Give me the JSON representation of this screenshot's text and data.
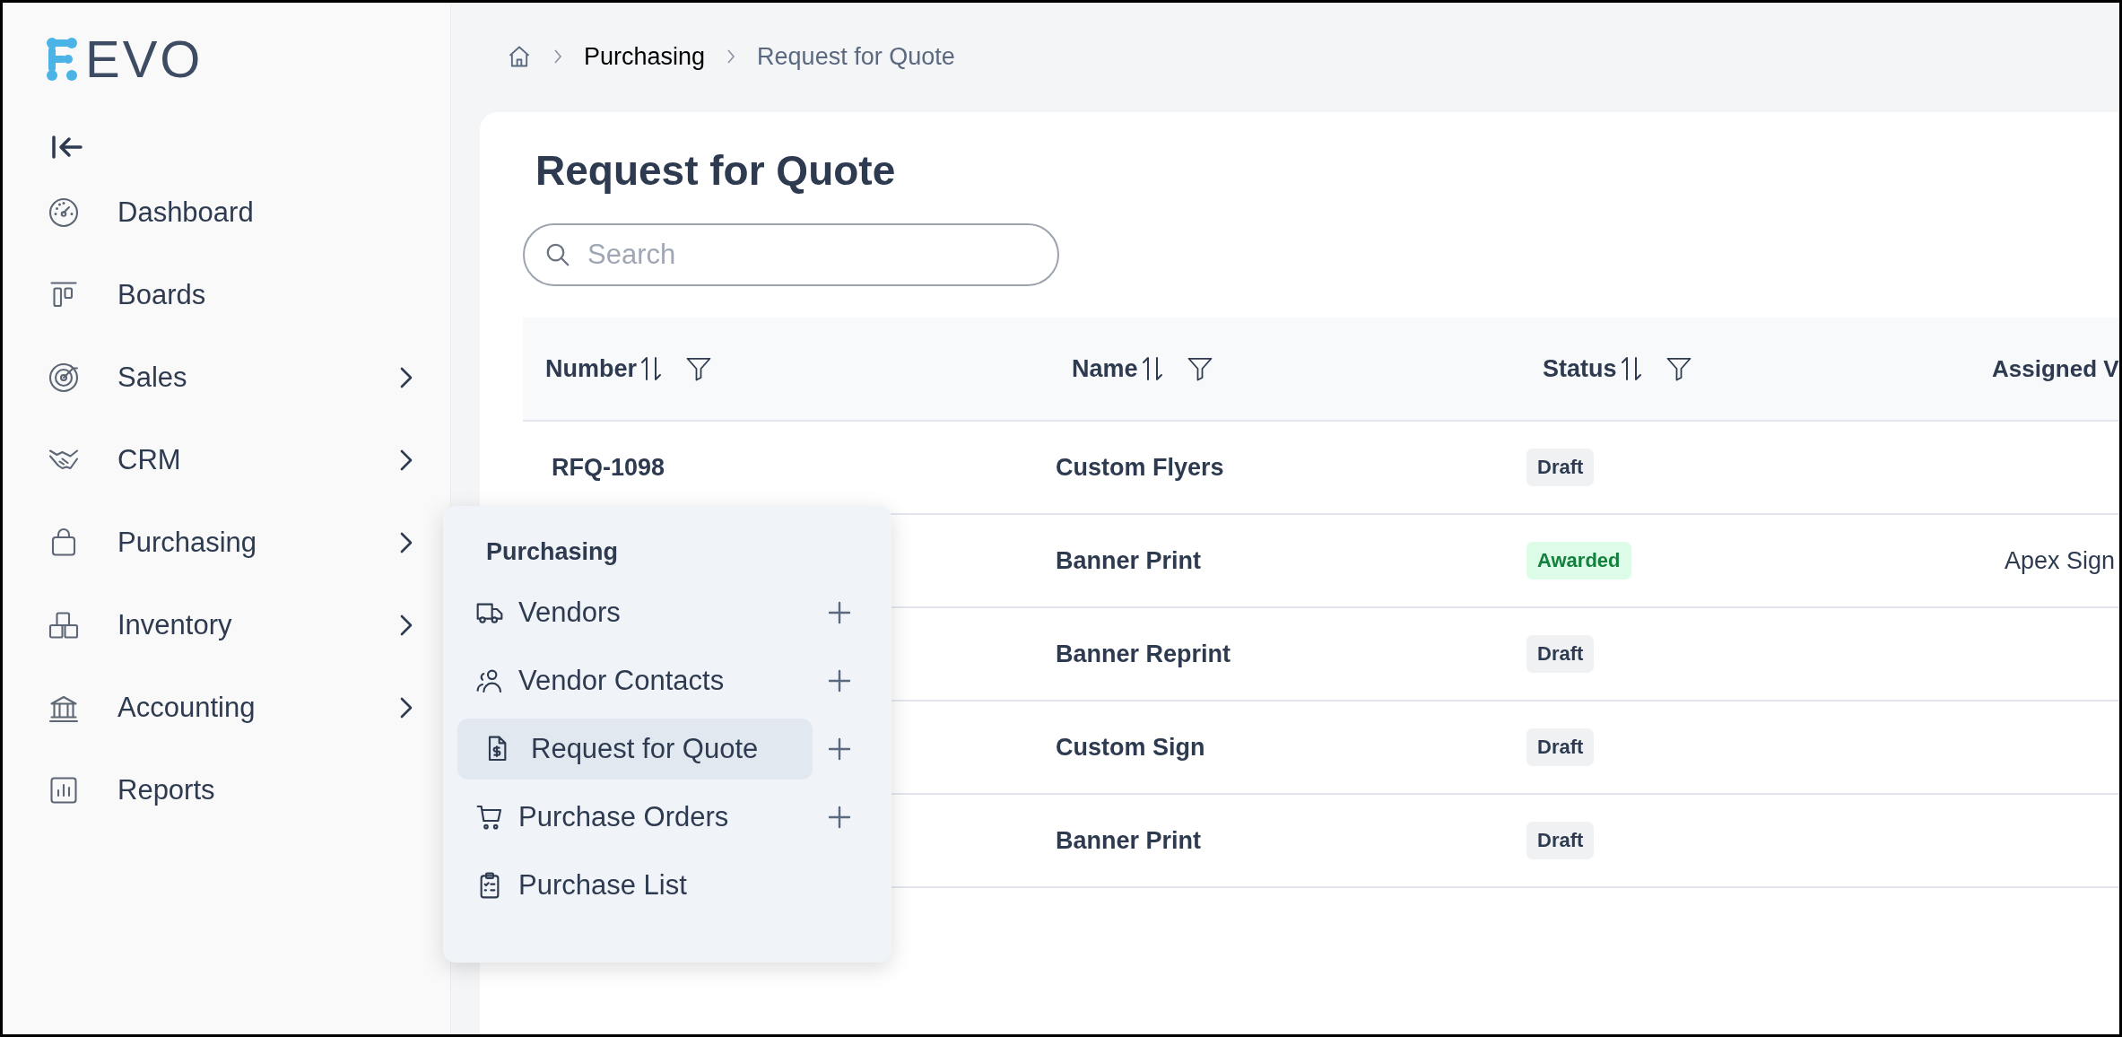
{
  "sidebar": {
    "logo": "EVO",
    "items": [
      {
        "label": "Dashboard",
        "submenu": false
      },
      {
        "label": "Boards",
        "submenu": false
      },
      {
        "label": "Sales",
        "submenu": true
      },
      {
        "label": "CRM",
        "submenu": true
      },
      {
        "label": "Purchasing",
        "submenu": true
      },
      {
        "label": "Inventory",
        "submenu": true
      },
      {
        "label": "Accounting",
        "submenu": true
      },
      {
        "label": "Reports",
        "submenu": false
      }
    ]
  },
  "breadcrumb": [
    {
      "label": "Purchasing",
      "current": false
    },
    {
      "label": "Request for Quote",
      "current": true
    }
  ],
  "page": {
    "title": "Request for Quote",
    "search": {
      "placeholder": "Search"
    }
  },
  "table": {
    "columns": [
      {
        "label": "Number",
        "sortable": true,
        "filterable": true
      },
      {
        "label": "Name",
        "sortable": true,
        "filterable": true
      },
      {
        "label": "Status",
        "sortable": true,
        "filterable": true
      },
      {
        "label": "Assigned V"
      }
    ],
    "rows": [
      {
        "number": "RFQ-1098",
        "name": "Custom Flyers",
        "status": {
          "label": "Draft",
          "kind": "draft"
        }
      },
      {
        "name": "Banner Print",
        "status": {
          "label": "Awarded",
          "kind": "awarded"
        },
        "assigned": "Apex Sign"
      },
      {
        "name": "Banner Reprint",
        "status": {
          "label": "Draft",
          "kind": "draft"
        }
      },
      {
        "name": "Custom Sign",
        "status": {
          "label": "Draft",
          "kind": "draft"
        }
      },
      {
        "name": "Banner Print",
        "status": {
          "label": "Draft",
          "kind": "draft"
        }
      }
    ]
  },
  "flyout": {
    "title": "Purchasing",
    "items": [
      {
        "label": "Vendors",
        "selected": false,
        "addable": true
      },
      {
        "label": "Vendor Contacts",
        "selected": false,
        "addable": true
      },
      {
        "label": "Request for Quote",
        "selected": true,
        "addable": true
      },
      {
        "label": "Purchase Orders",
        "selected": false,
        "addable": true
      },
      {
        "label": "Purchase List",
        "selected": false,
        "addable": false
      }
    ]
  }
}
